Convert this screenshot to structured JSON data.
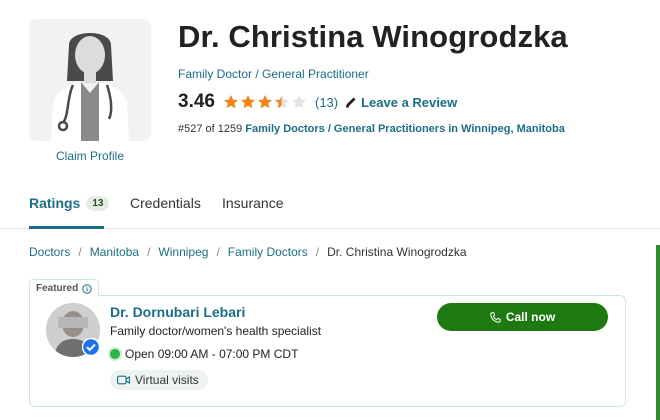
{
  "profile": {
    "name": "Dr. Christina Winogrodzka",
    "specialty": "Family Doctor / General Practitioner",
    "claim_label": "Claim Profile",
    "rating": "3.46",
    "rating_stars": 3.46,
    "rating_max": 5,
    "rating_count": "(13)",
    "review_label": "Leave a Review",
    "rank_prefix": "#527 of 1259",
    "rank_link": "Family Doctors / General Practitioners in Winnipeg, Manitoba"
  },
  "tabs": [
    {
      "label": "Ratings",
      "badge": "13"
    },
    {
      "label": "Credentials"
    },
    {
      "label": "Insurance"
    }
  ],
  "breadcrumb": {
    "items": [
      "Doctors",
      "Manitoba",
      "Winnipeg",
      "Family Doctors"
    ],
    "separator": "/",
    "current": "Dr. Christina Winogrodzka"
  },
  "featured": {
    "tag_label": "Featured",
    "name": "Dr. Dornubari Lebari",
    "description": "Family doctor/women's health specialist",
    "status": "Open",
    "hours": "09:00 AM - 07:00 PM CDT",
    "visit_type": "Virtual visits",
    "call_label": "Call now"
  },
  "colors": {
    "accent": "#1b6e86",
    "star": "#f5821f",
    "call_button": "#1d7a10",
    "open_status": "#2bb24c"
  },
  "icons": [
    "doctor-avatar-icon",
    "star-icon",
    "pencil-icon",
    "info-icon",
    "verified-check-icon",
    "phone-icon",
    "video-icon"
  ]
}
